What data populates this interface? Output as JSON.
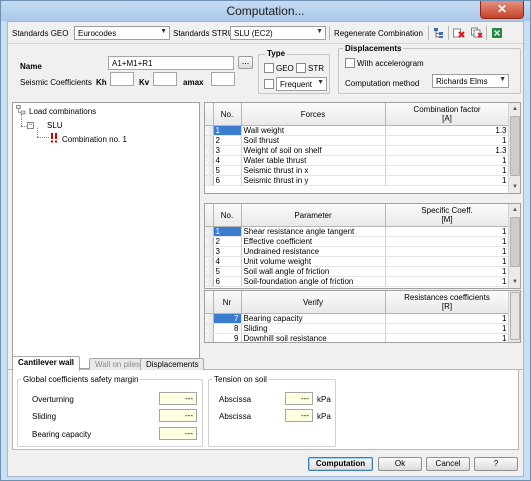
{
  "window": {
    "title": "Computation...",
    "close_label": "✕"
  },
  "toolbar": {
    "standards_geo_label": "Standards GEO",
    "standards_geo_value": "Eurocodes",
    "standards_stru_label": "Standards STRU",
    "standards_stru_value": "SLU (EC2)",
    "regenerate_label": "Regenerate Combination",
    "icons": [
      "tree-settings-icon",
      "delete-x-icon",
      "delete-all-icon",
      "export-excel-icon"
    ]
  },
  "name_section": {
    "name_label": "Name",
    "name_value": "A1+M1+R1",
    "browse_label": "...",
    "seismic_label": "Seismic Coefficients",
    "kh_label": "Kh",
    "kh_value": "",
    "kv_label": "Kv",
    "kv_value": "",
    "amax_label": "amax",
    "amax_value": ""
  },
  "type_group": {
    "title": "Type",
    "geo_label": "GEO",
    "str_label": "STR",
    "frequency_value": "Frequent"
  },
  "displacements_group": {
    "title": "Displacements",
    "accelerogram_label": "With accelerogram",
    "method_label": "Computation method",
    "method_value": "Richards Elms"
  },
  "tree": {
    "root_label": "Load combinations",
    "child_label": "SLU",
    "leaf_label": "Combination no. 1"
  },
  "forces_table": {
    "headers": [
      "No.",
      "Forces",
      "Combination factor\n[A]"
    ],
    "rows": [
      {
        "no": "1",
        "name": "Wall weight",
        "value": "1.3"
      },
      {
        "no": "2",
        "name": "Soil thrust",
        "value": "1"
      },
      {
        "no": "3",
        "name": "Weight of soil on shelf",
        "value": "1.3"
      },
      {
        "no": "4",
        "name": "Water table thrust",
        "value": "1"
      },
      {
        "no": "5",
        "name": "Seismic thrust in x",
        "value": "1"
      },
      {
        "no": "6",
        "name": "Seismic thrust in y",
        "value": "1"
      }
    ]
  },
  "parameters_table": {
    "headers": [
      "No.",
      "Parameter",
      "Specific Coeff.\n[M]"
    ],
    "rows": [
      {
        "no": "1",
        "name": "Shear resistance angle tangent",
        "value": "1"
      },
      {
        "no": "2",
        "name": "Effective coefficient",
        "value": "1"
      },
      {
        "no": "3",
        "name": "Undrained resistance",
        "value": "1"
      },
      {
        "no": "4",
        "name": "Unit volume weight",
        "value": "1"
      },
      {
        "no": "5",
        "name": "Soil wall angle of friction",
        "value": "1"
      },
      {
        "no": "6",
        "name": "Soil-foundation angle of friction",
        "value": "1"
      }
    ]
  },
  "verify_table": {
    "headers": [
      "Nr",
      "Verify",
      "Resistances coefficients\n[R]"
    ],
    "rows": [
      {
        "no": "7",
        "name": "Bearing capacity",
        "value": "1"
      },
      {
        "no": "8",
        "name": "Sliding",
        "value": "1"
      },
      {
        "no": "9",
        "name": "Downhill soil resistance",
        "value": "1"
      }
    ]
  },
  "tabs": [
    "Cantilever wall",
    "Wall on piles",
    "Displacements"
  ],
  "safety_group": {
    "title": "Global coefficients safety margin",
    "items": [
      {
        "label": "Overturning",
        "value": "---"
      },
      {
        "label": "Sliding",
        "value": "---"
      },
      {
        "label": "Bearing capacity",
        "value": "---"
      }
    ]
  },
  "tension_group": {
    "title": "Tension on soil",
    "items": [
      {
        "label": "Abscissa",
        "value": "---",
        "unit": "kPa"
      },
      {
        "label": "Abscissa",
        "value": "---",
        "unit": "kPa"
      }
    ]
  },
  "footer": {
    "computation_label": "Computation",
    "ok_label": "Ok",
    "cancel_label": "Cancel",
    "help_label": "?"
  }
}
